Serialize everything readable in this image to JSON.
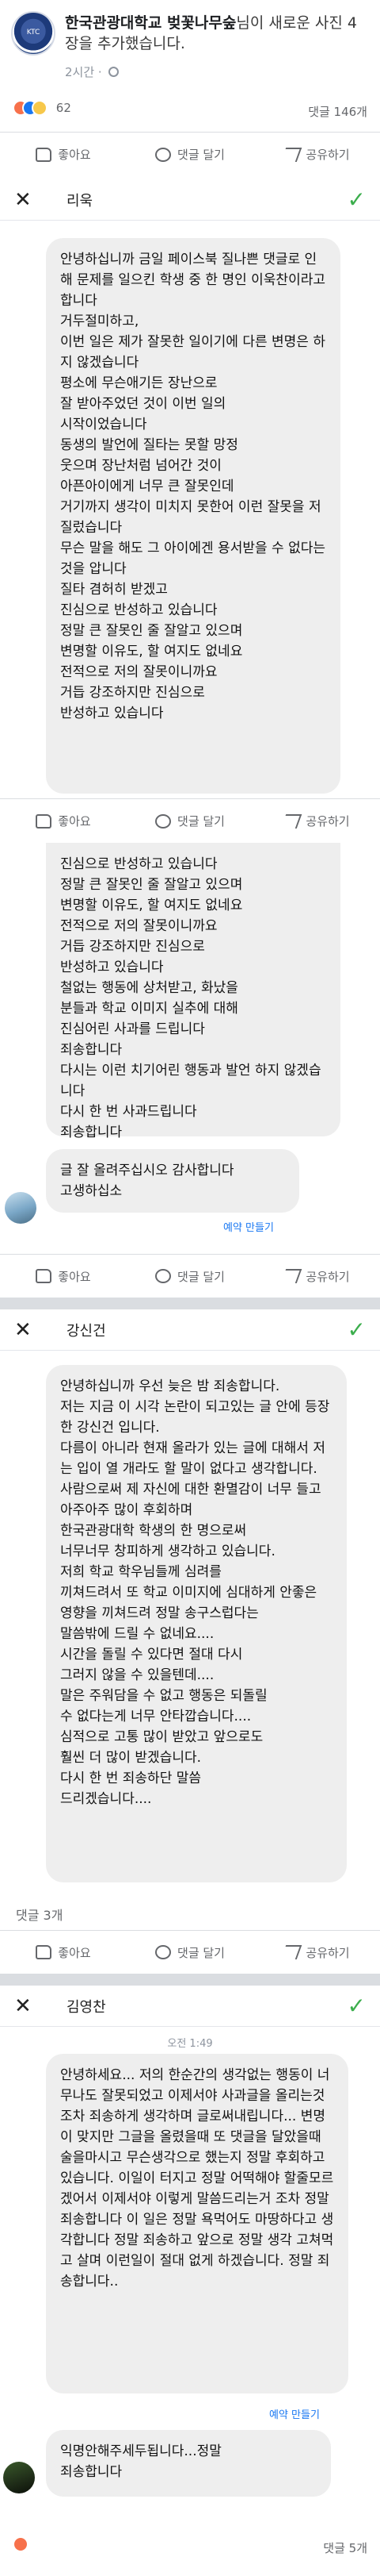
{
  "post": {
    "page_name": "한국관광대학교 벚꽃나무숲",
    "title_suffix": "님이 새로운 사진 4장을 추가했습니다.",
    "time": "2시간",
    "avatar_text": "KTC",
    "reactions_count": "62",
    "comments_count": "댓글 146개"
  },
  "actions": {
    "like": "좋아요",
    "comment": "댓글 달기",
    "share": "공유하기"
  },
  "screen1": {
    "contact": "리욱",
    "message": "안녕하십니까 금일 페이스북 질나쁜 댓글로 인해 문제를 일으킨 학생 중 한 명인 이욱찬이라고합니다\n거두절미하고,\n이번 일은 제가 잘못한 일이기에 다른 변명은 하지 않겠습니다\n평소에 무슨애기든 장난으로\n잘 받아주었던 것이 이번 일의\n시작이었습니다\n동생의 발언에 질타는 못할 망정\n웃으며 장난처럼 넘어간 것이\n아픈아이에게 너무 큰 잘못인데\n거기까지 생각이 미치지 못한어 이런 잘못을 저질렀습니다\n무슨 말을 해도 그 아이에겐 용서받을 수 없다는 것을 압니다\n질타 겸허히 받겠고\n진심으로 반성하고 있습니다\n정말 큰 잘못인 줄 잘알고 있으며\n변명할 이유도, 할 여지도 없네요\n전적으로 저의 잘못이니까요\n거듭 강조하지만 진심으로\n반성하고 있습니다"
  },
  "screen2": {
    "message": "진심으로 반성하고 있습니다\n정말 큰 잘못인 줄 잘알고 있으며\n변명할 이유도, 할 여지도 없네요\n전적으로 저의 잘못이니까요\n거듭 강조하지만 진심으로\n반성하고 있습니다\n철없는 행동에 상처받고, 화났을\n분들과 학교 이미지 실추에 대해\n진심어린 사과를 드립니다\n죄송합니다\n다시는 이런 치기어린 행동과 발언 하지 않겠습니다\n다시 한 번 사과드립니다\n죄송합니다",
    "reply": "글 잘 올려주십시오 감사합니다\n고생하십소",
    "reply_link": "예약 만들기"
  },
  "screen3": {
    "contact": "강신건",
    "message": "안녕하십니까 우선 늦은 밤 죄송합니다.\n저는 지금 이 시각 논란이 되고있는 글 안에 등장한 강신건 입니다.\n다름이 아니라 현재 올라가 있는 글에 대해서 저는 입이 열 개라도 할 말이 없다고 생각합니다.\n사람으로써 제 자신에 대한 환멸감이 너무 들고 아주아주 많이 후회하며\n한국관광대학 학생의 한 명으로써\n너무너무 창피하게 생각하고 있습니다.\n저희 학교 학우님들께 심려를\n끼쳐드려서 또 학교 이미지에 심대하게 안좋은\n영향을 끼쳐드려 정말 송구스럽다는\n말씀밖에 드릴 수 없네요....\n시간을 돌릴 수 있다면 절대 다시\n그러지 않을 수 있을텐데....\n말은 주워담을 수 없고 행동은 되돌릴\n수 없다는게 너무 안타깝습니다....\n심적으로 고통 많이 받았고 앞으로도\n훨씬 더 많이 받겠습니다.\n다시 한 번 죄송하단 말씀\n드리겠습니다....",
    "comments_label": "댓글 3개"
  },
  "screen4": {
    "contact": "김영찬",
    "time": "오전 1:49",
    "message": "안녕하세요... 저의 한순간의 생각없는 행동이 너무나도 잘못되었고 이제서야 사과글을 올리는것 조차 죄송하게 생각하며 글로써내립니다... 변명이 맞지만 그글을 올렸을때 또 댓글을 달았을때 술을마시고 무슨생각으로 했는지 정말 후회하고 있습니다. 이일이 터지고 정말 어떡해야 할줄모르겠어서 이제서야 이렇게 말씀드리는거 조차 정말 죄송합니다 이 일은 정말 욕먹어도 마땅하다고 생각합니다 정말 죄송하고 앞으로 정말 생각 고쳐먹고 살며 이런일이 절대 없게 하겠습니다. 정말 죄송합니다..",
    "reply_link": "예약 만들기",
    "reply": "익명안해주세두됩니다...정말\n죄송합니다",
    "comments_label": "댓글 5개"
  }
}
